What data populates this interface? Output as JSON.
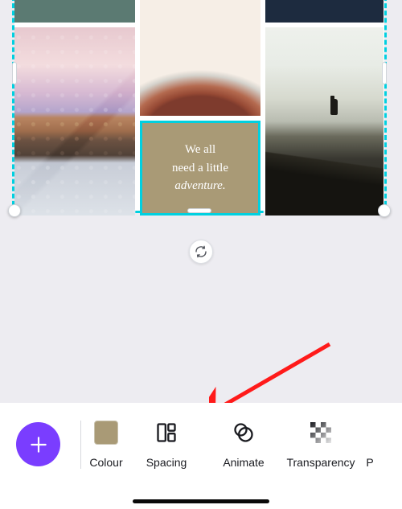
{
  "quote": {
    "line1": "We all",
    "line2": "need a little",
    "line3_em": "adventure."
  },
  "toolbar": {
    "colour_label": "Colour",
    "spacing_label": "Spacing",
    "animate_label": "Animate",
    "transparency_label": "Transparency",
    "partial_label": "P"
  },
  "colors": {
    "accent": "#00d0e0",
    "fab": "#7a3dff",
    "swatch": "#a99a76"
  }
}
